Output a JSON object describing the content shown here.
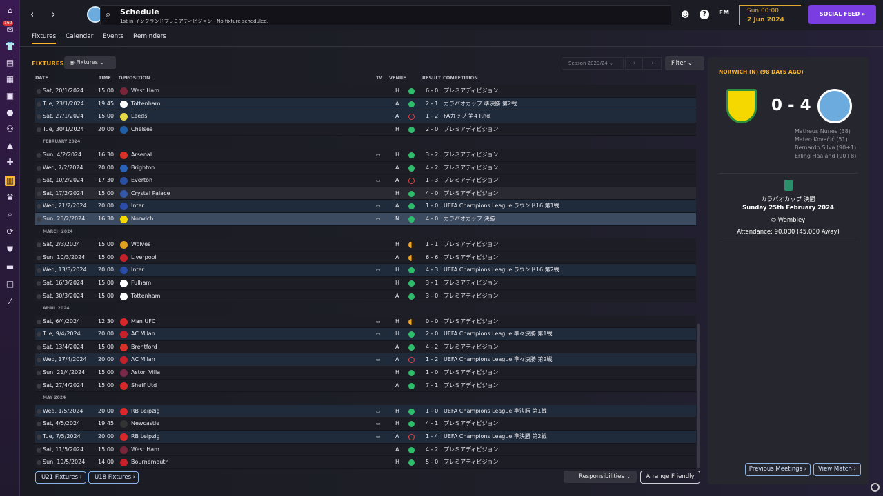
{
  "header": {
    "title": "Schedule",
    "subtitle": "1st in イングランドプレミアディビジョン - No fixture scheduled.",
    "fm": "FM",
    "time": "Sun 00:00",
    "date": "2 Jun 2024",
    "social": "SOCIAL FEED",
    "badge": "160",
    "help": "?"
  },
  "tabs": [
    "Fixtures",
    "Calendar",
    "Events",
    "Reminders"
  ],
  "fixtures": {
    "label": "FIXTURES",
    "dropdown": "Fixtures",
    "season": "Season 2023/24",
    "filter": "Filter",
    "columns": {
      "date": "DATE",
      "time": "TIME",
      "opp": "OPPOSITION",
      "tv": "TV",
      "venue": "VENUE",
      "result": "RESULT",
      "comp": "COMPETITION"
    },
    "rows": [
      {
        "date": "Sat, 20/1/2024",
        "time": "15:00",
        "opp": "West Ham",
        "tv": false,
        "v": "H",
        "r": "W",
        "s": "6 - 0",
        "c": "プレミアディビジョン",
        "crest": "#7a263a",
        "bg": "ev"
      },
      {
        "date": "Tue, 23/1/2024",
        "time": "19:45",
        "opp": "Tottenham",
        "tv": false,
        "v": "A",
        "r": "W",
        "s": "2 - 1",
        "c": "カラバオカップ 準決勝 第2戦",
        "crest": "#ffffff",
        "bg": "eu"
      },
      {
        "date": "Sat, 27/1/2024",
        "time": "15:00",
        "opp": "Leeds",
        "tv": false,
        "v": "A",
        "r": "L",
        "s": "1 - 2",
        "c": "FAカップ 第4 Rnd",
        "crest": "#e7d84a",
        "bg": "eu"
      },
      {
        "date": "Tue, 30/1/2024",
        "time": "20:00",
        "opp": "Chelsea",
        "tv": false,
        "v": "H",
        "r": "W",
        "s": "2 - 0",
        "c": "プレミアディビジョン",
        "crest": "#1f5fa8",
        "bg": "ev"
      },
      {
        "month": "FEBRUARY 2024"
      },
      {
        "date": "Sun, 4/2/2024",
        "time": "16:30",
        "opp": "Arsenal",
        "tv": true,
        "v": "H",
        "r": "W",
        "s": "3 - 2",
        "c": "プレミアディビジョン",
        "crest": "#d8302a",
        "bg": "ev"
      },
      {
        "date": "Wed, 7/2/2024",
        "time": "20:00",
        "opp": "Brighton",
        "tv": false,
        "v": "A",
        "r": "W",
        "s": "4 - 2",
        "c": "プレミアディビジョン",
        "crest": "#2a62b8",
        "bg": "ev"
      },
      {
        "date": "Sat, 10/2/2024",
        "time": "17:30",
        "opp": "Everton",
        "tv": true,
        "v": "A",
        "r": "L",
        "s": "1 - 3",
        "c": "プレミアディビジョン",
        "crest": "#2b4fa0",
        "bg": "ev"
      },
      {
        "date": "Sat, 17/2/2024",
        "time": "15:00",
        "opp": "Crystal Palace",
        "tv": false,
        "v": "H",
        "r": "W",
        "s": "4 - 0",
        "c": "プレミアディビジョン",
        "crest": "#3357a6",
        "bg": "hl"
      },
      {
        "date": "Wed, 21/2/2024",
        "time": "20:00",
        "opp": "Inter",
        "tv": true,
        "v": "A",
        "r": "W",
        "s": "1 - 0",
        "c": "UEFA Champions League ラウンド16 第1戦",
        "crest": "#2b4da8",
        "bg": "eu"
      },
      {
        "date": "Sun, 25/2/2024",
        "time": "16:30",
        "opp": "Norwich",
        "tv": true,
        "v": "N",
        "r": "W",
        "s": "4 - 0",
        "c": "カラバオカップ 決勝",
        "crest": "#f5d800",
        "bg": "sel"
      },
      {
        "month": "MARCH 2024"
      },
      {
        "date": "Sat, 2/3/2024",
        "time": "15:00",
        "opp": "Wolves",
        "tv": false,
        "v": "H",
        "r": "D",
        "s": "1 - 1",
        "c": "プレミアディビジョン",
        "crest": "#e0a020",
        "bg": "ev"
      },
      {
        "date": "Sun, 10/3/2024",
        "time": "15:00",
        "opp": "Liverpool",
        "tv": false,
        "v": "A",
        "r": "D",
        "s": "6 - 6",
        "c": "プレミアディビジョン",
        "crest": "#c8202a",
        "bg": "ev"
      },
      {
        "date": "Wed, 13/3/2024",
        "time": "20:00",
        "opp": "Inter",
        "tv": true,
        "v": "H",
        "r": "W",
        "s": "4 - 3",
        "c": "UEFA Champions League ラウンド16 第2戦",
        "crest": "#2b4da8",
        "bg": "eu"
      },
      {
        "date": "Sat, 16/3/2024",
        "time": "15:00",
        "opp": "Fulham",
        "tv": false,
        "v": "H",
        "r": "W",
        "s": "3 - 1",
        "c": "プレミアディビジョン",
        "crest": "#ffffff",
        "bg": "ev"
      },
      {
        "date": "Sat, 30/3/2024",
        "time": "15:00",
        "opp": "Tottenham",
        "tv": false,
        "v": "A",
        "r": "W",
        "s": "3 - 0",
        "c": "プレミアディビジョン",
        "crest": "#ffffff",
        "bg": "ev"
      },
      {
        "month": "APRIL 2024"
      },
      {
        "date": "Sat, 6/4/2024",
        "time": "12:30",
        "opp": "Man UFC",
        "tv": true,
        "v": "H",
        "r": "D",
        "s": "0 - 0",
        "c": "プレミアディビジョン",
        "crest": "#d8282a",
        "bg": "ev"
      },
      {
        "date": "Tue, 9/4/2024",
        "time": "20:00",
        "opp": "AC Milan",
        "tv": true,
        "v": "H",
        "r": "W",
        "s": "2 - 0",
        "c": "UEFA Champions League 準々決勝 第1戦",
        "crest": "#c8202a",
        "bg": "eu"
      },
      {
        "date": "Sat, 13/4/2024",
        "time": "15:00",
        "opp": "Brentford",
        "tv": false,
        "v": "A",
        "r": "W",
        "s": "4 - 2",
        "c": "プレミアディビジョン",
        "crest": "#d8302a",
        "bg": "ev"
      },
      {
        "date": "Wed, 17/4/2024",
        "time": "20:00",
        "opp": "AC Milan",
        "tv": true,
        "v": "A",
        "r": "L",
        "s": "1 - 2",
        "c": "UEFA Champions League 準々決勝 第2戦",
        "crest": "#c8202a",
        "bg": "eu"
      },
      {
        "date": "Sun, 21/4/2024",
        "time": "15:00",
        "opp": "Aston Villa",
        "tv": false,
        "v": "H",
        "r": "W",
        "s": "1 - 0",
        "c": "プレミアディビジョン",
        "crest": "#7a2a48",
        "bg": "ev"
      },
      {
        "date": "Sat, 27/4/2024",
        "time": "15:00",
        "opp": "Sheff Utd",
        "tv": false,
        "v": "A",
        "r": "W",
        "s": "7 - 1",
        "c": "プレミアディビジョン",
        "crest": "#d8282a",
        "bg": "ev"
      },
      {
        "month": "MAY 2024"
      },
      {
        "date": "Wed, 1/5/2024",
        "time": "20:00",
        "opp": "RB Leipzig",
        "tv": true,
        "v": "H",
        "r": "W",
        "s": "1 - 0",
        "c": "UEFA Champions League 準決勝 第1戦",
        "crest": "#d8282a",
        "bg": "eu"
      },
      {
        "date": "Sat, 4/5/2024",
        "time": "19:45",
        "opp": "Newcastle",
        "tv": true,
        "v": "H",
        "r": "W",
        "s": "4 - 1",
        "c": "プレミアディビジョン",
        "crest": "#333333",
        "bg": "ev"
      },
      {
        "date": "Tue, 7/5/2024",
        "time": "20:00",
        "opp": "RB Leipzig",
        "tv": true,
        "v": "A",
        "r": "L",
        "s": "1 - 4",
        "c": "UEFA Champions League 準決勝 第2戦",
        "crest": "#d8282a",
        "bg": "eu"
      },
      {
        "date": "Sat, 11/5/2024",
        "time": "15:00",
        "opp": "West Ham",
        "tv": false,
        "v": "A",
        "r": "W",
        "s": "4 - 2",
        "c": "プレミアディビジョン",
        "crest": "#7a263a",
        "bg": "ev"
      },
      {
        "date": "Sun, 19/5/2024",
        "time": "14:00",
        "opp": "Bournemouth",
        "tv": false,
        "v": "H",
        "r": "W",
        "s": "5 - 0",
        "c": "プレミアディビジョン",
        "crest": "#c8202a",
        "bg": "ev"
      }
    ]
  },
  "buttons": {
    "u21": "U21 Fixtures",
    "u18": "U18 Fixtures",
    "responsibilities": "Responsibilities",
    "arrange": "Arrange Friendly"
  },
  "match": {
    "title": "NORWICH (N) (98 DAYS AGO)",
    "score": "0 - 4",
    "scorers": [
      "Matheus Nunes (38)",
      "Mateo Kovačić (51)",
      "Bernardo Silva (90+1)",
      "Erling Haaland (90+8)"
    ],
    "competition": "カラバオカップ 決勝",
    "date": "Sunday 25th February 2024",
    "stadium": "Wembley",
    "attendance": "Attendance: 90,000 (45,000 Away)",
    "prev": "Previous Meetings",
    "view": "View Match"
  }
}
